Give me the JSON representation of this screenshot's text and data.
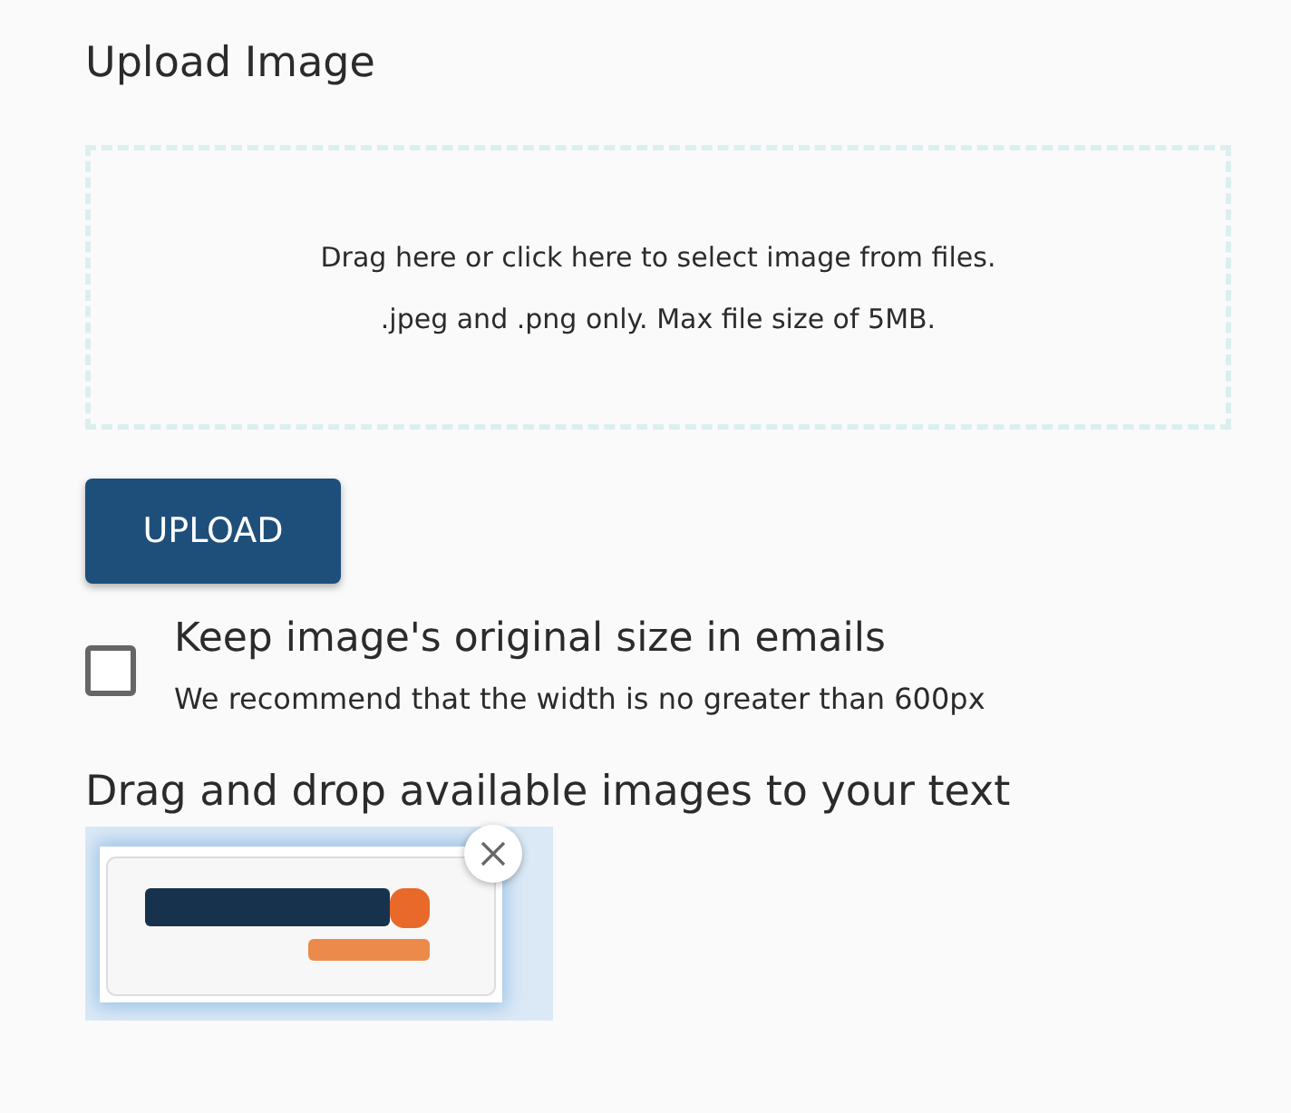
{
  "title": "Upload Image",
  "dropzone": {
    "lines": [
      "Drag here or click here to select image from files.",
      ".jpeg and .png only. Max file size of 5MB."
    ]
  },
  "upload_button": "UPLOAD",
  "keep_size": {
    "checked": false,
    "label": "Keep image's original size in emails",
    "hint": "We recommend that the width is no greater than 600px"
  },
  "images_heading": "Drag and drop available images to your text"
}
